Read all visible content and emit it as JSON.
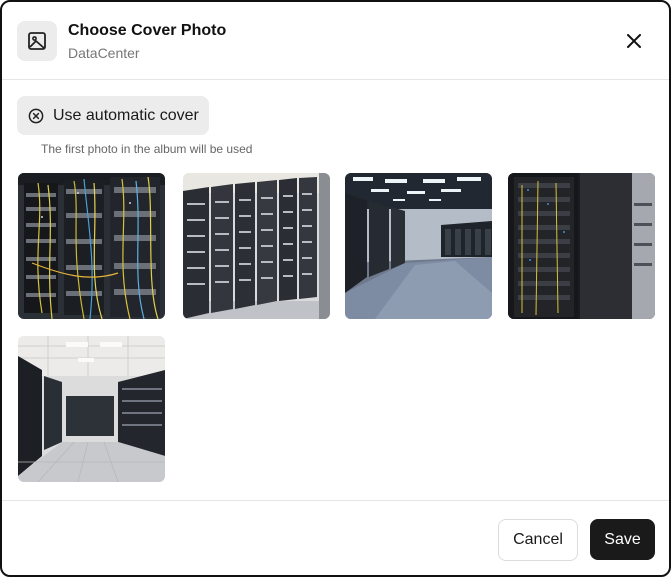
{
  "dialog": {
    "title": "Choose Cover Photo",
    "subtitle": "DataCenter",
    "header_icon": "image-icon",
    "close_icon": "close-icon"
  },
  "auto_cover": {
    "label": "Use automatic cover",
    "icon": "circle-x-icon",
    "hint": "The first photo in the album will be used"
  },
  "photos": [
    {
      "name": "photo-cabling-racks"
    },
    {
      "name": "photo-server-aisle"
    },
    {
      "name": "photo-server-hall-lit"
    },
    {
      "name": "photo-dark-racks"
    },
    {
      "name": "photo-white-room-racks"
    }
  ],
  "footer": {
    "cancel_label": "Cancel",
    "save_label": "Save"
  },
  "colors": {
    "save_bg": "#1a1a1a",
    "chip_bg": "#ececec"
  }
}
